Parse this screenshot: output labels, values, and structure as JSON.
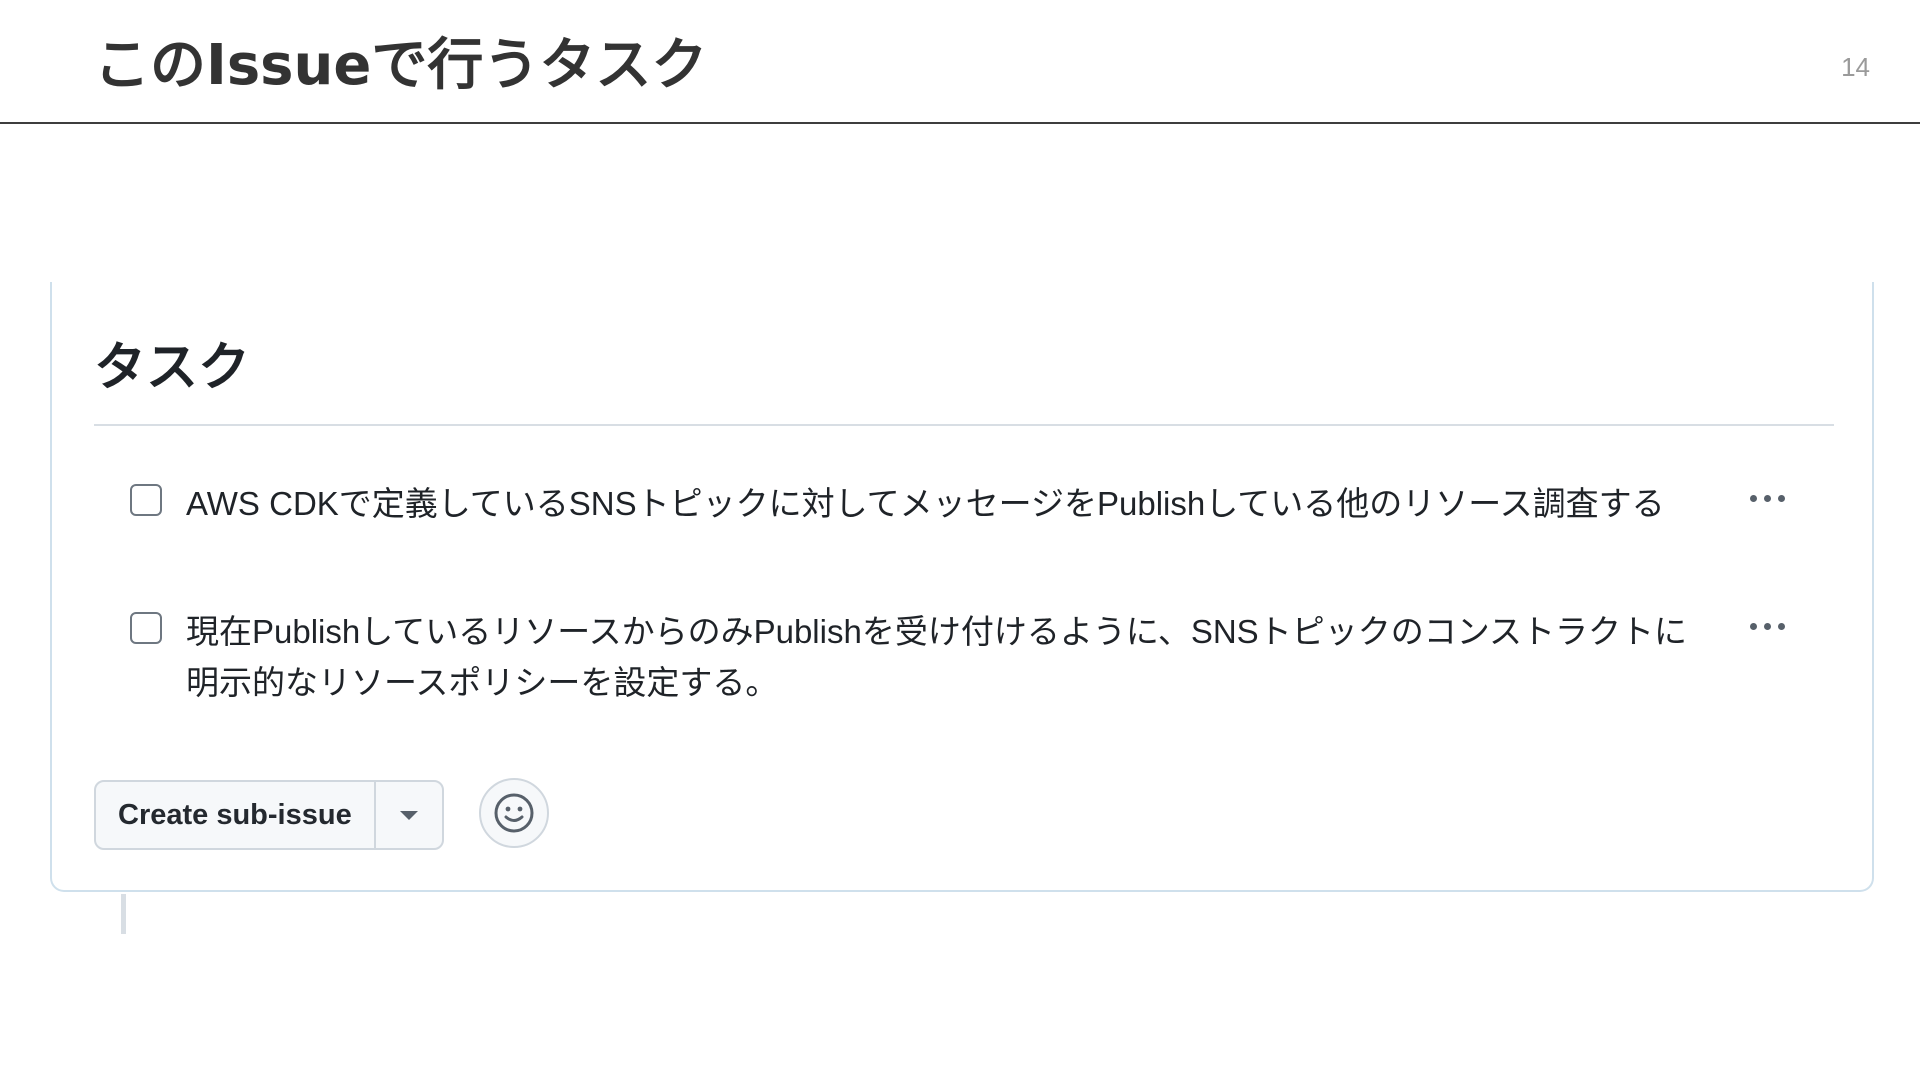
{
  "slide": {
    "title": "このIssueで行うタスク",
    "page_number": "14"
  },
  "issue": {
    "section_heading": "タスク",
    "tasks": [
      {
        "label": "AWS CDKで定義しているSNSトピックに対してメッセージをPublishしている他のリソース調査する",
        "checked": false,
        "menu_icon": "kebab-horizontal-icon"
      },
      {
        "label": "現在PublishしているリソースからのみPublishを受け付けるように、SNSトピックのコンストラクトに明示的なリソースポリシーを設定する。",
        "checked": false,
        "menu_icon": "kebab-horizontal-icon"
      }
    ],
    "actions": {
      "create_sub_issue_label": "Create sub-issue",
      "dropdown_icon": "triangle-down-icon",
      "reaction_icon": "smiley-icon"
    }
  },
  "colors": {
    "title_text": "#333333",
    "body_text": "#1f2328",
    "border": "#d0d7de",
    "card_border": "#cfe0ec",
    "button_bg": "#f6f8fa"
  }
}
